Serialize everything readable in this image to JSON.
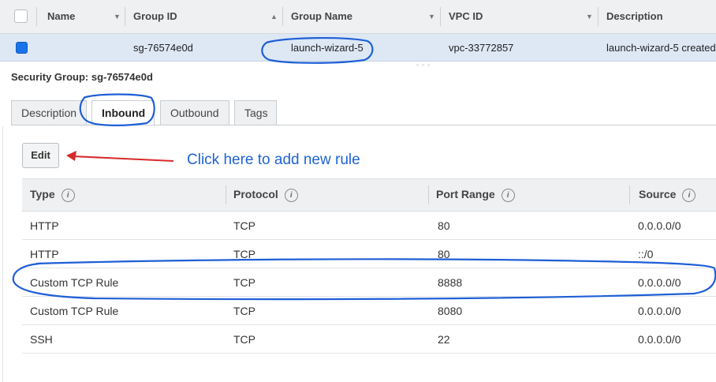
{
  "grid": {
    "headers": {
      "name": "Name",
      "group_id": "Group ID",
      "group_name": "Group Name",
      "vpc_id": "VPC ID",
      "description": "Description"
    },
    "row": {
      "group_id": "sg-76574e0d",
      "group_name": "launch-wizard-5",
      "vpc_id": "vpc-33772857",
      "description": "launch-wizard-5 created"
    }
  },
  "details": {
    "title": "Security Group: sg-76574e0d"
  },
  "tabs": [
    {
      "label": "Description"
    },
    {
      "label": "Inbound"
    },
    {
      "label": "Outbound"
    },
    {
      "label": "Tags"
    }
  ],
  "edit_label": "Edit",
  "annotation": {
    "text": "Click here to add new rule"
  },
  "rules": {
    "headers": {
      "type": "Type",
      "protocol": "Protocol",
      "port_range": "Port Range",
      "source": "Source"
    },
    "rows": [
      {
        "type": "HTTP",
        "protocol": "TCP",
        "port": "80",
        "source": "0.0.0.0/0"
      },
      {
        "type": "HTTP",
        "protocol": "TCP",
        "port": "80",
        "source": "::/0"
      },
      {
        "type": "Custom TCP Rule",
        "protocol": "TCP",
        "port": "8888",
        "source": "0.0.0.0/0"
      },
      {
        "type": "Custom TCP Rule",
        "protocol": "TCP",
        "port": "8080",
        "source": "0.0.0.0/0"
      },
      {
        "type": "SSH",
        "protocol": "TCP",
        "port": "22",
        "source": "0.0.0.0/0"
      }
    ]
  },
  "colors": {
    "highlight_ink": "#1f5fd6",
    "arrow_ink": "#d62a2a",
    "selected_row": "#dde8f4"
  },
  "icons": {
    "info": "info-circle-icon",
    "sort_asc": "sort-ascending-icon",
    "sort_desc": "sort-descending-icon"
  }
}
